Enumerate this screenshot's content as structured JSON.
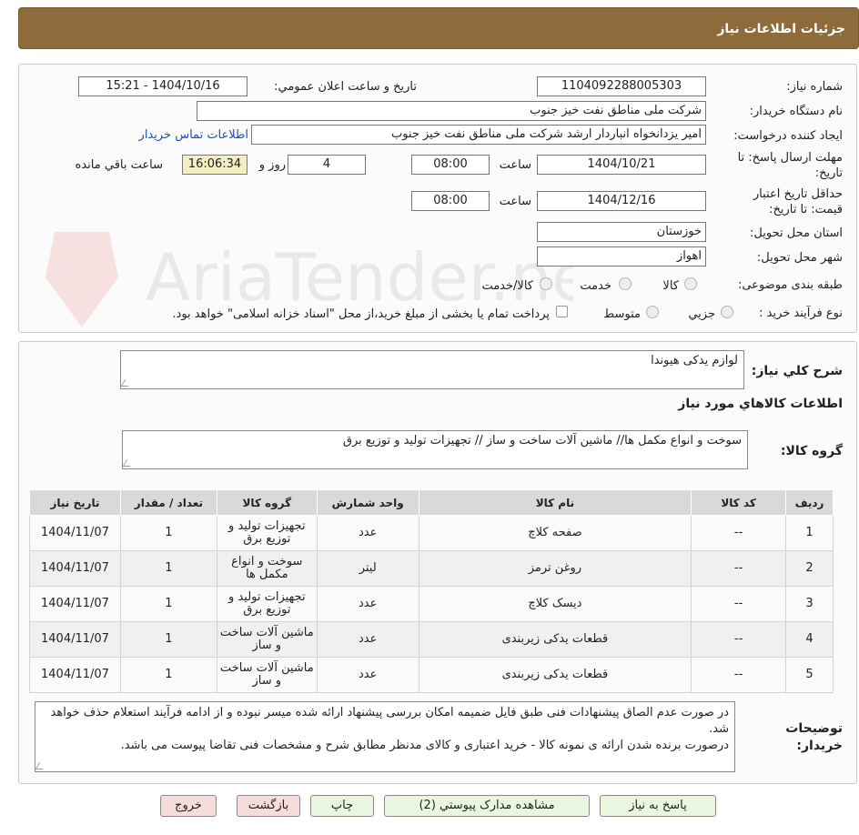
{
  "header": {
    "title": "جزئیات اطلاعات نیاز"
  },
  "form": {
    "need_number_label": "شماره نیاز:",
    "need_number": "1104092288005303",
    "announce_label": "تاریخ و ساعت اعلان عمومي:",
    "announce_value": "1404/10/16 - 15:21",
    "buyer_org_label": "نام دستگاه خريدار:",
    "buyer_org": "شرکت ملی مناطق نفت خیز جنوب",
    "requester_label": "ايجاد کننده درخواست:",
    "requester": "امیر یزدانخواه انباردار ارشد شرکت ملی مناطق نفت خیز جنوب",
    "contact_link": "اطلاعات تماس خريدار",
    "reply_deadline_label": "مهلت ارسال پاسخ: تا تاريخ:",
    "reply_date": "1404/10/21",
    "time_label": "ساعت",
    "reply_time": "08:00",
    "days": "4",
    "days_label": "روز و",
    "remaining_time": "16:06:34",
    "remaining_label": "ساعت باقي مانده",
    "validity_label": "حداقل تاريخ اعتبار قيمت: تا تاريخ:",
    "validity_date": "1404/12/16",
    "validity_time": "08:00",
    "province_label": "استان محل تحويل:",
    "province": "خوزستان",
    "city_label": "شهر محل تحويل:",
    "city": "اهواز",
    "category_label": "طبقه بندی موضوعی:",
    "category_options": [
      "کالا",
      "خدمت",
      "کالا/خدمت"
    ],
    "process_label": "نوع فرآيند خريد :",
    "process_options": [
      "جزیي",
      "متوسط"
    ],
    "payment_note": "پرداخت تمام يا بخشی از مبلغ خريد،از محل \"اسناد خزانه اسلامی\" خواهد بود."
  },
  "watermark": {
    "text": "AriaTender.neT"
  },
  "details": {
    "description_label": "شرح کلي نياز:",
    "description": "لوازم یدکی هیوندا",
    "goods_info_title": "اطلاعات کالاهاي مورد نياز",
    "goods_group_label": "گروه کالا:",
    "goods_group": "سوخت و انواع مکمل ها// ماشین آلات ساخت و ساز // تجهیزات تولید و توزیع برق",
    "table_headers": [
      "رديف",
      "کد کالا",
      "نام کالا",
      "واحد شمارش",
      "گروه کالا",
      "تعداد / مقدار",
      "تاريخ نياز"
    ],
    "rows": [
      {
        "n": "1",
        "code": "--",
        "name": "صفحه کلاچ",
        "unit": "عدد",
        "group": "تجهیزات تولید و توزیع برق",
        "qty": "1",
        "date": "1404/11/07"
      },
      {
        "n": "2",
        "code": "--",
        "name": "روغن ترمز",
        "unit": "لیتر",
        "group": "سوخت و انواع مکمل ها",
        "qty": "1",
        "date": "1404/11/07"
      },
      {
        "n": "3",
        "code": "--",
        "name": "دیسک کلاچ",
        "unit": "عدد",
        "group": "تجهیزات تولید و توزیع برق",
        "qty": "1",
        "date": "1404/11/07"
      },
      {
        "n": "4",
        "code": "--",
        "name": "قطعات یدکی زیربندی",
        "unit": "عدد",
        "group": "ماشین آلات ساخت و ساز",
        "qty": "1",
        "date": "1404/11/07"
      },
      {
        "n": "5",
        "code": "--",
        "name": "قطعات یدکی زیربندی",
        "unit": "عدد",
        "group": "ماشین آلات ساخت و ساز",
        "qty": "1",
        "date": "1404/11/07"
      }
    ],
    "buyer_notes_label": "توضيحات خريدار:",
    "buyer_notes_line1": "در صورت عدم الصاق پیشنهادات فنی طبق فایل ضمیمه امکان بررسی پیشنهاد ارائه شده میسر نبوده و از ادامه فرآیند استعلام حذف خواهد شد.",
    "buyer_notes_line2": "درصورت برنده شدن ارائه ی نمونه کالا - خرید اعتباری و کالای مدنظر مطابق شرح و مشخصات فنی تقاضا پیوست می باشد."
  },
  "buttons": {
    "reply": "پاسخ به نياز",
    "attachments": "مشاهده مدارک پيوستي (2)",
    "print": "چاپ",
    "back": "بازگشت",
    "exit": "خروج"
  },
  "colors": {
    "header_bg": "#8d6b3b",
    "link": "#1a4fc2",
    "remaining_bg": "#f3efc2"
  }
}
